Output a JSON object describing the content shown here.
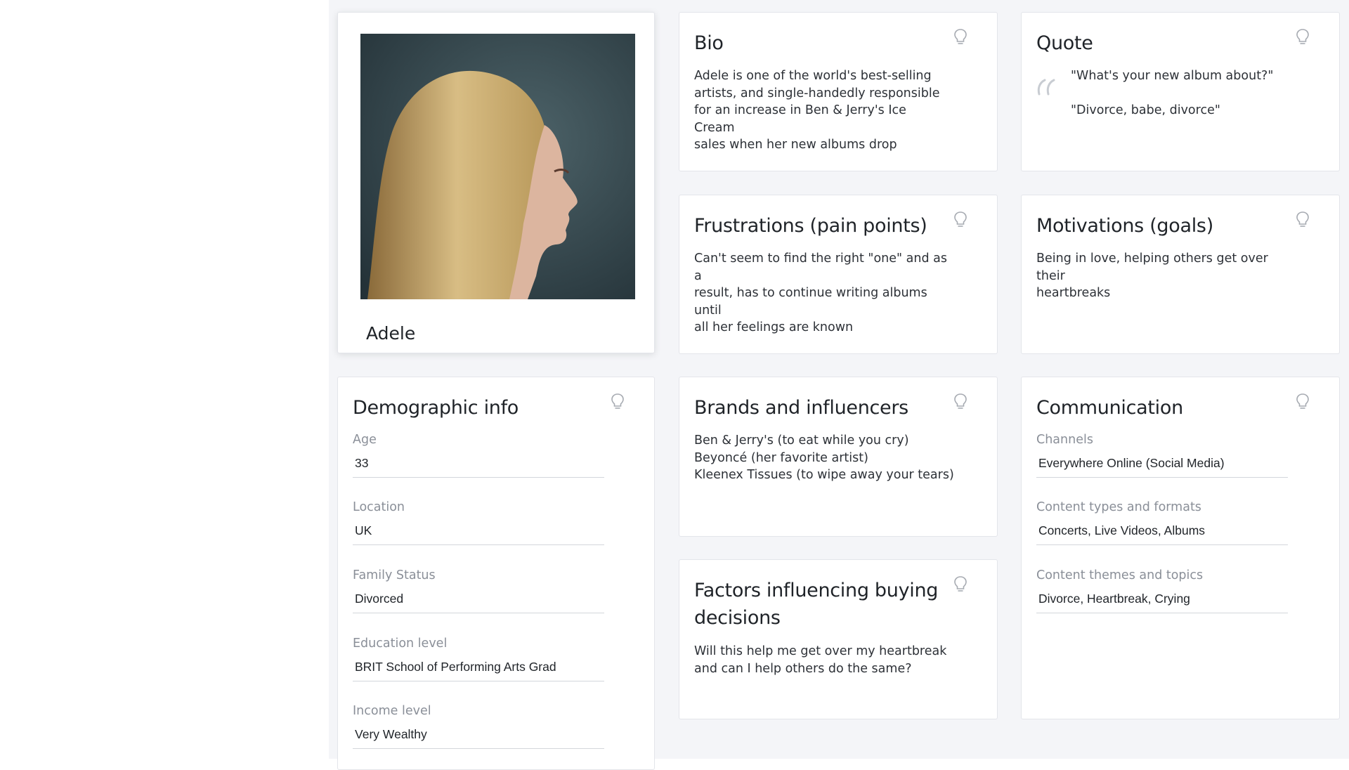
{
  "profile": {
    "name": "Adele"
  },
  "bio": {
    "title": "Bio",
    "text": "Adele is one of the world's best-selling\nartists, and single-handedly responsible\nfor an increase in Ben & Jerry's Ice Cream\nsales when her new albums drop"
  },
  "quote": {
    "title": "Quote",
    "lines": [
      "\"What's your new album about?\"",
      "\"Divorce, babe, divorce\""
    ]
  },
  "frustrations": {
    "title": "Frustrations (pain points)",
    "text": "Can't seem to find the right \"one\" and as a\nresult, has to continue writing albums until\nall her feelings are known"
  },
  "motivations": {
    "title": "Motivations (goals)",
    "text": "Being in love, helping others get over their\nheartbreaks"
  },
  "demographic": {
    "title": "Demographic info",
    "fields": [
      {
        "label": "Age",
        "value": "33"
      },
      {
        "label": "Location",
        "value": "UK"
      },
      {
        "label": "Family Status",
        "value": "Divorced"
      },
      {
        "label": "Education level",
        "value": "BRIT School of Performing Arts Grad"
      },
      {
        "label": "Income level",
        "value": "Very Wealthy"
      }
    ]
  },
  "brands": {
    "title": "Brands and influencers",
    "text": "Ben & Jerry's (to eat while you cry)\nBeyoncé (her favorite artist)\nKleenex Tissues (to wipe away your tears)"
  },
  "factors": {
    "title": "Factors influencing buying\ndecisions",
    "text": "Will this help me get over my heartbreak\nand can I help others do the same?"
  },
  "communication": {
    "title": "Communication",
    "fields": [
      {
        "label": "Channels",
        "value": "Everywhere Online (Social Media)"
      },
      {
        "label": "Content types and formats",
        "value": "Concerts, Live Videos, Albums"
      },
      {
        "label": "Content themes and topics",
        "value": "Divorce, Heartbreak, Crying"
      }
    ]
  },
  "icons": {
    "hint": "lightbulb-icon",
    "quote": "quote-icon"
  },
  "colors": {
    "background": "#f4f5f8",
    "card": "#ffffff",
    "muted_label": "#8a8f98",
    "underline": "#d3d6db"
  }
}
